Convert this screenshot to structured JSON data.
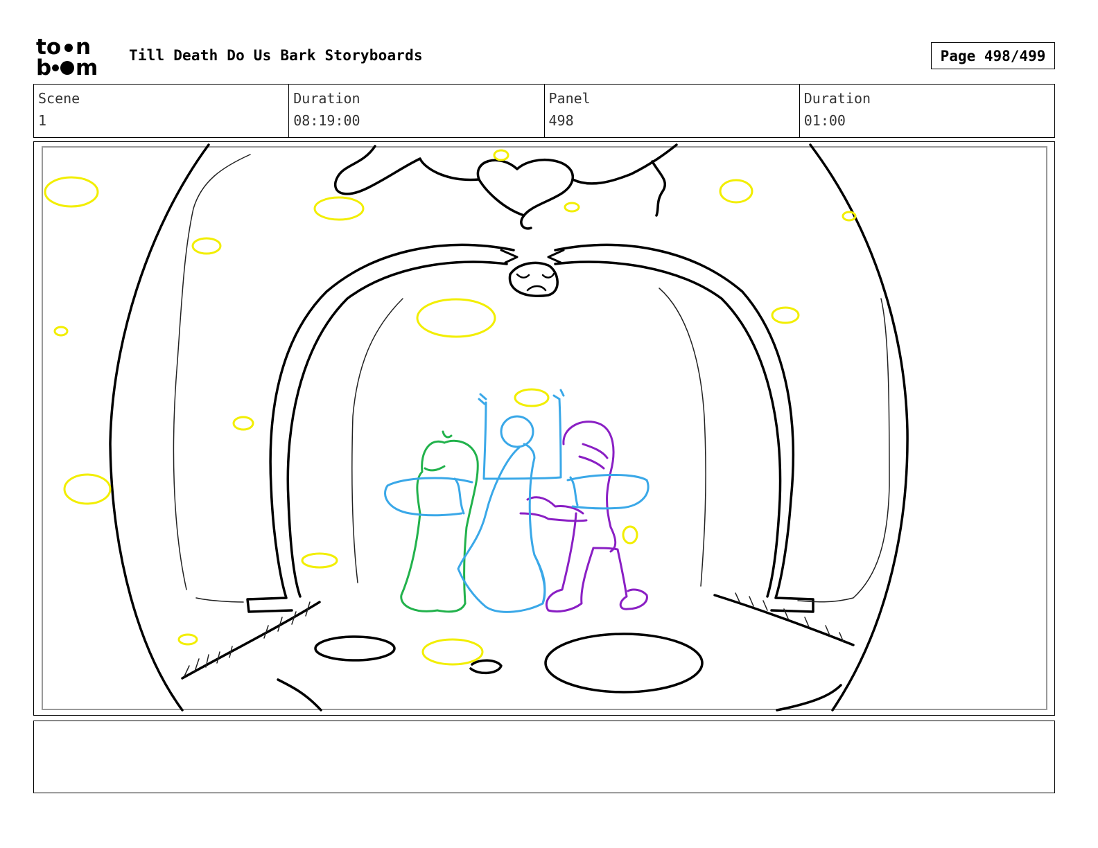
{
  "header": {
    "logo_top": "to",
    "logo_top_end": "n",
    "logo_bottom_start": "b",
    "logo_bottom_end": "m",
    "title": "Till Death Do Us Bark Storyboards",
    "page": "Page 498/499"
  },
  "info": {
    "scene_label": "Scene",
    "scene_value": "1",
    "duration_label": "Duration",
    "duration_value": "08:19:00",
    "panel_label": "Panel",
    "panel_value": "498",
    "panel_duration_label": "Duration",
    "panel_duration_value": "01:00"
  },
  "notes": {
    "text": ""
  },
  "colors": {
    "outline": "#000000",
    "halo": "#f2ee00",
    "green_character": "#22b24c",
    "blue_character": "#3aa8e8",
    "purple_character": "#8a1fc4"
  }
}
